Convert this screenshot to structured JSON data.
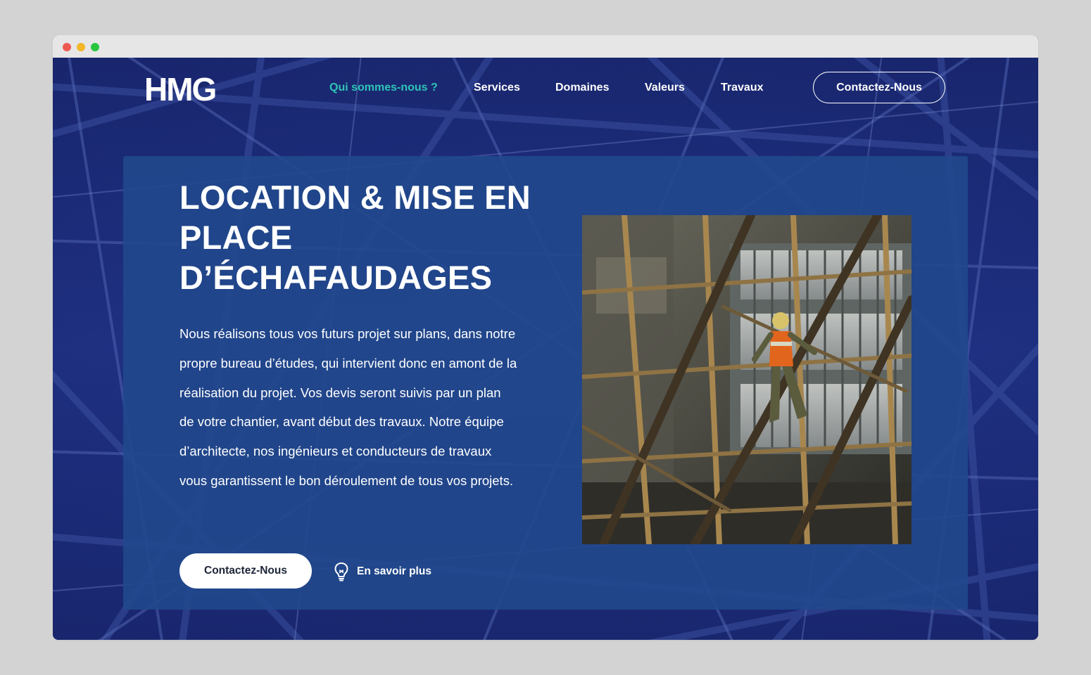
{
  "brand": {
    "logo_text": "HMG"
  },
  "nav": {
    "items": [
      {
        "label": "Qui sommes-nous ?",
        "active": true
      },
      {
        "label": "Services",
        "active": false
      },
      {
        "label": "Domaines",
        "active": false
      },
      {
        "label": "Valeurs",
        "active": false
      },
      {
        "label": "Travaux",
        "active": false
      }
    ],
    "cta_label": "Contactez-Nous"
  },
  "hero": {
    "headline_lines": [
      "LOCATION & MISE EN",
      "PLACE",
      "D’ÉCHAFAUDAGES"
    ],
    "body_text": "Nous réalisons tous vos futurs projet sur plans, dans notre propre bureau d’études, qui intervient donc en amont de la réalisation du projet. Vos devis seront suivis par un plan de votre chantier, avant début des travaux. Notre équipe d’architecte, nos ingénieurs et conducteurs de travaux vous garantissent le bon déroulement de tous vos projets.",
    "primary_button_label": "Contactez-Nous",
    "secondary_link_label": "En savoir plus",
    "secondary_link_icon": "lightbulb-icon"
  },
  "colors": {
    "accent": "#2ec4b6",
    "background": "#1b2a73",
    "panel": "#21488c",
    "text": "#ffffff"
  }
}
